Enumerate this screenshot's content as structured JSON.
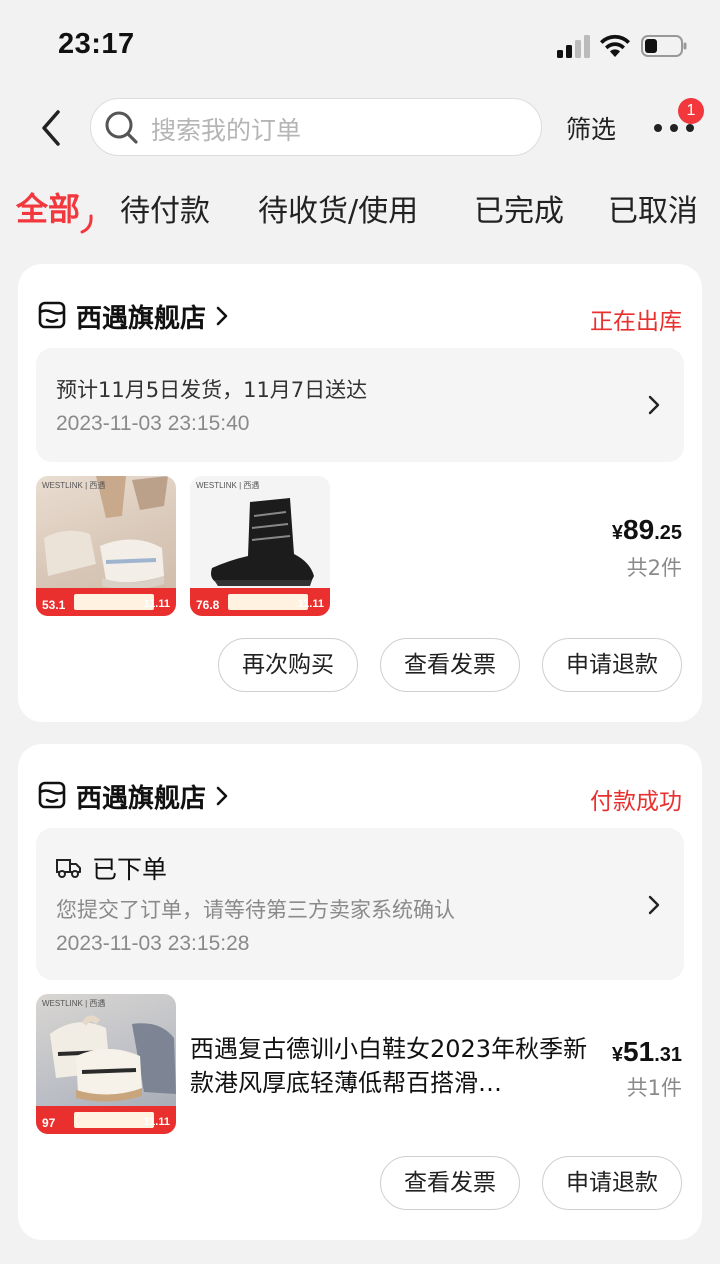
{
  "status_bar": {
    "time": "23:17"
  },
  "header": {
    "search_placeholder": "搜索我的订单",
    "filter_label": "筛选",
    "more_badge": "1"
  },
  "tabs": [
    {
      "label": "全部",
      "active": true
    },
    {
      "label": "待付款",
      "active": false
    },
    {
      "label": "待收货/使用",
      "active": false
    },
    {
      "label": "已完成",
      "active": false
    },
    {
      "label": "已取消",
      "active": false
    }
  ],
  "orders": [
    {
      "store_name": "西遇旗舰店",
      "status": "正在出库",
      "info_line1": "预计11月5日发货，11月7日送达",
      "info_time": "2023-11-03 23:15:40",
      "thumbs": [
        {
          "brand": "WESTLINK | 西遇",
          "price": "53.1",
          "badge": "11.11"
        },
        {
          "brand": "WESTLINK | 西遇",
          "price": "76.8",
          "badge": "11.11"
        }
      ],
      "price_yen": "¥",
      "price_int": "89",
      "price_dec": ".25",
      "qty": "共2件",
      "buttons": [
        "再次购买",
        "查看发票",
        "申请退款"
      ]
    },
    {
      "store_name": "西遇旗舰店",
      "status": "付款成功",
      "info_title": "已下单",
      "info_line2": "您提交了订单，请等待第三方卖家系统确认",
      "info_time": "2023-11-03 23:15:28",
      "thumbs": [
        {
          "brand": "WESTLINK | 西遇",
          "price": "97",
          "badge": "11.11"
        }
      ],
      "product_title": "西遇复古德训小白鞋女2023年秋季新款港风厚底轻薄低帮百搭滑…",
      "price_yen": "¥",
      "price_int": "51",
      "price_dec": ".31",
      "qty": "共1件",
      "buttons": [
        "查看发票",
        "申请退款"
      ]
    }
  ],
  "colors": {
    "accent": "#f2373d",
    "status_red": "#e8312f",
    "background": "#f2f2f2"
  }
}
